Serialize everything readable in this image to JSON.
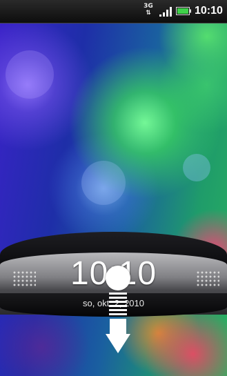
{
  "status_bar": {
    "network_type": "3G",
    "network_arrows": "⇅",
    "signal_icon": "signal-bars-icon",
    "battery_icon": "battery-icon",
    "time": "10:10"
  },
  "lock_screen": {
    "clock": "10:10",
    "date": "so, okt. 2, 2010",
    "unlock_icon": "pull-down-arrow-icon"
  },
  "colors": {
    "status_bar": "#111111",
    "battery_fill": "#3fd04a",
    "band": "#2a2a2d"
  }
}
